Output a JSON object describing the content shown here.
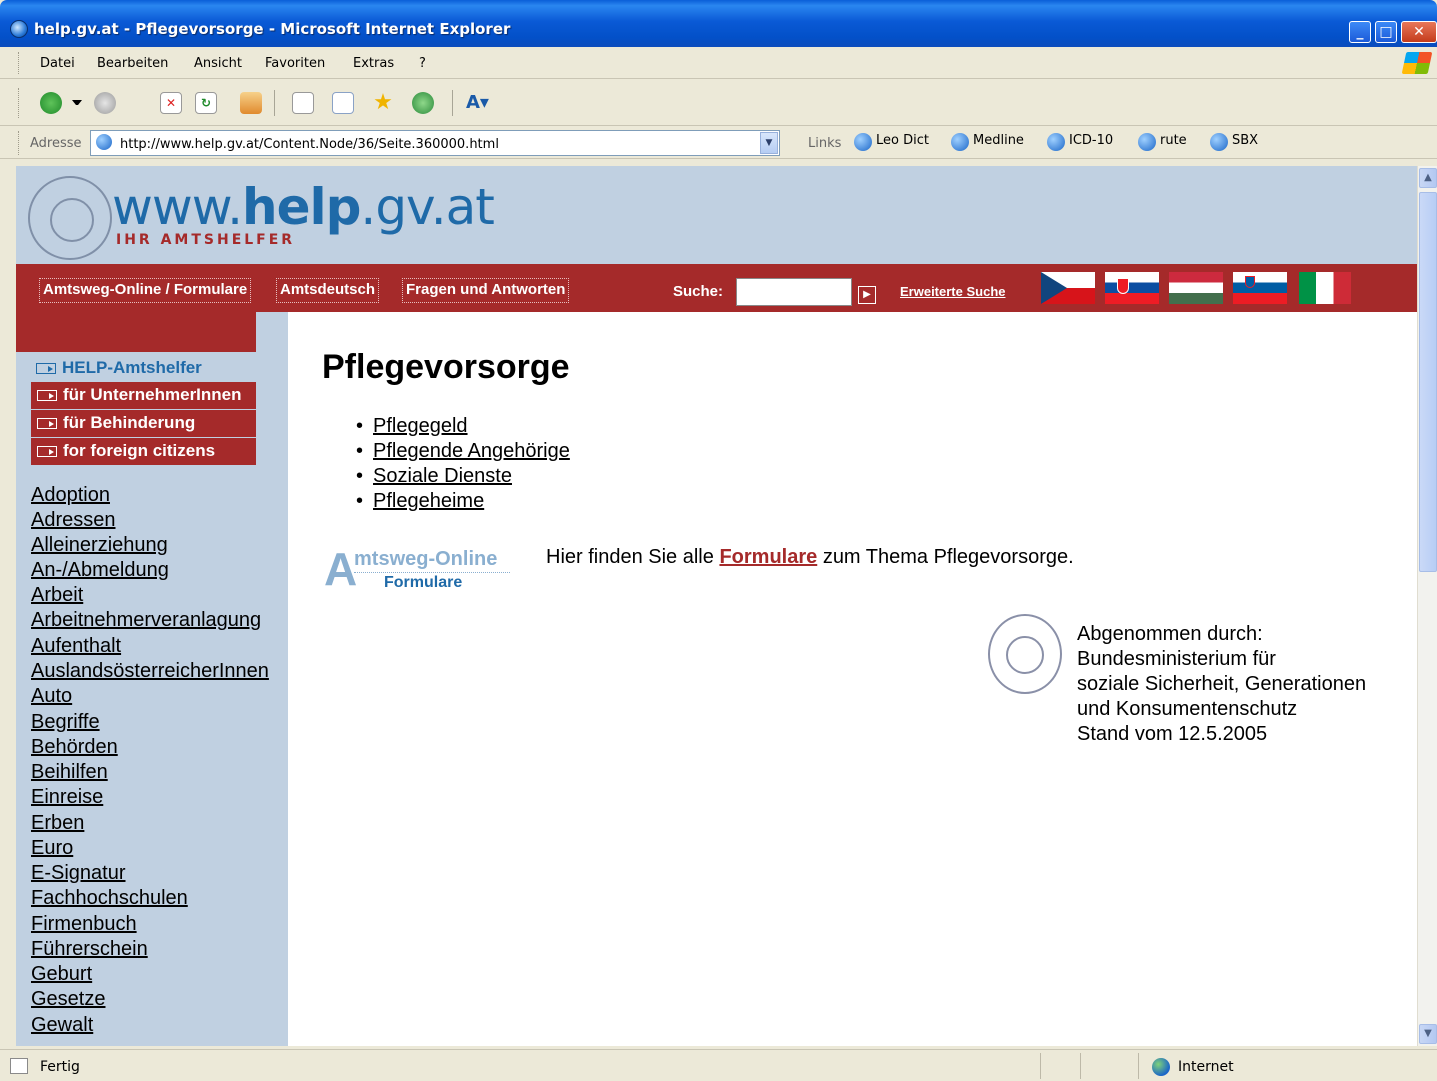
{
  "window": {
    "title": "help.gv.at - Pflegevorsorge - Microsoft Internet Explorer",
    "controls": [
      "minimize",
      "maximize",
      "close"
    ]
  },
  "menubar": {
    "items": [
      "Datei",
      "Bearbeiten",
      "Ansicht",
      "Favoriten",
      "Extras",
      "?"
    ]
  },
  "toolbar": {
    "icons": [
      "back-icon",
      "forward-icon",
      "stop-icon",
      "refresh-icon",
      "home-icon",
      "mail-icon",
      "search-icon",
      "favorites-icon",
      "history-icon",
      "font-icon"
    ]
  },
  "addressbar": {
    "label": "Adresse",
    "url": "http://www.help.gv.at/Content.Node/36/Seite.360000.html",
    "links_label": "Links",
    "links": [
      "Leo Dict",
      "Medline",
      "ICD-10",
      "rute",
      "SBX"
    ]
  },
  "site": {
    "logo_text_pre": "www.",
    "logo_text_bold": "help",
    "logo_text_post": ".gv.at",
    "logo_sub": "IHR AMTSHELFER",
    "nav": [
      "Amtsweg-Online / Formulare",
      "Amtsdeutsch",
      "Fragen und Antworten"
    ],
    "search_label": "Suche:",
    "search_value": "",
    "advanced_search": "Erweiterte Suche",
    "flags": [
      "czech-flag",
      "slovak-flag",
      "hungarian-flag",
      "slovenian-flag",
      "italian-flag"
    ]
  },
  "sidebar": {
    "main": "HELP-Amtshelfer",
    "subs": [
      "für UnternehmerInnen",
      "für Behinderung",
      "for foreign citizens"
    ],
    "topics": [
      "Adoption",
      "Adressen",
      "Alleinerziehung",
      "An-/Abmeldung",
      "Arbeit",
      "Arbeitnehmerveranlagung",
      "Aufenthalt",
      "AuslandsösterreicherInnen",
      "Auto",
      "Begriffe",
      "Behörden",
      "Beihilfen",
      "Einreise",
      "Erben",
      "Euro",
      "E-Signatur",
      "Fachhochschulen",
      "Firmenbuch",
      "Führerschein",
      "Geburt",
      "Gesetze",
      "Gewalt"
    ]
  },
  "content": {
    "title": "Pflegevorsorge",
    "links": [
      "Pflegegeld",
      "Pflegende Angehörige",
      "Soziale Dienste",
      "Pflegeheime"
    ],
    "amtsweg_logo_top": "mtsweg-Online",
    "amtsweg_logo_bottom": "Formulare",
    "form_text_pre": "Hier finden Sie alle",
    "form_text_link": "Formulare",
    "form_text_post": "zum Thema Pflegevorsorge.",
    "credit_lines": [
      "Abgenommen durch:",
      "Bundesministerium für",
      "soziale Sicherheit, Generationen",
      "und Konsumentenschutz",
      "Stand vom 12.5.2005"
    ]
  },
  "statusbar": {
    "text": "Fertig",
    "zone": "Internet"
  }
}
